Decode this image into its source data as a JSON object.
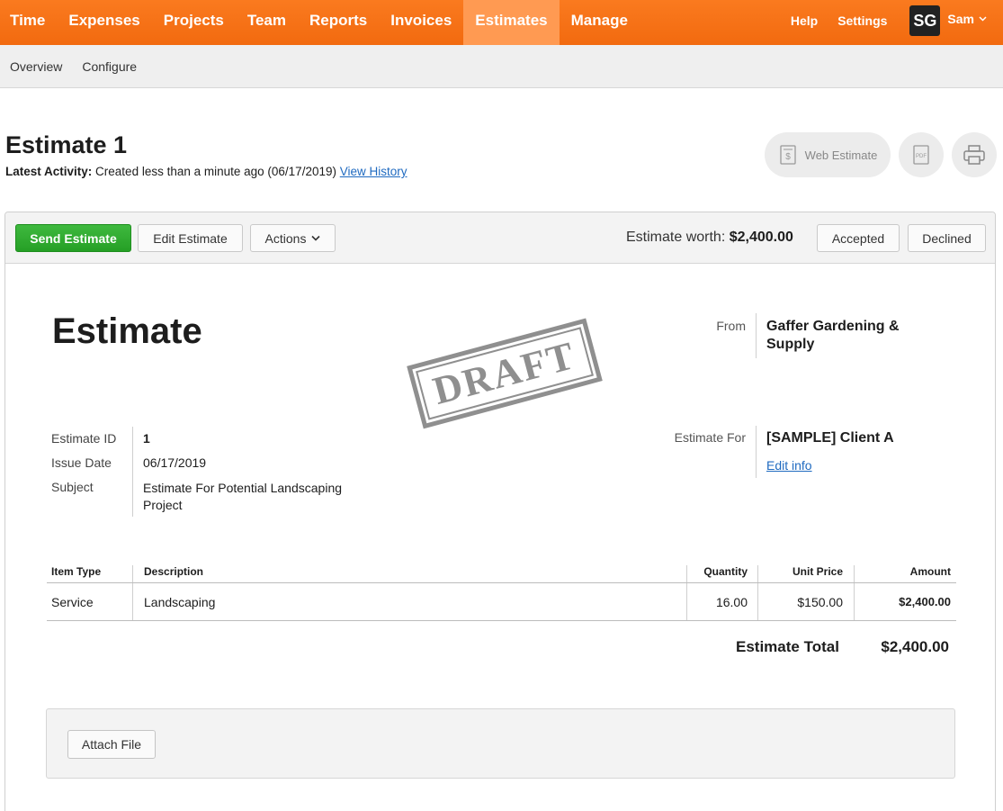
{
  "nav": {
    "items": [
      {
        "label": "Time",
        "active": false
      },
      {
        "label": "Expenses",
        "active": false
      },
      {
        "label": "Projects",
        "active": false
      },
      {
        "label": "Team",
        "active": false
      },
      {
        "label": "Reports",
        "active": false
      },
      {
        "label": "Invoices",
        "active": false
      },
      {
        "label": "Estimates",
        "active": true
      },
      {
        "label": "Manage",
        "active": false
      }
    ],
    "help": "Help",
    "settings": "Settings",
    "avatar_initials": "SG",
    "user_name": "Sam",
    "accent_color": "#f26a0f"
  },
  "subnav": {
    "items": [
      "Overview",
      "Configure"
    ]
  },
  "header": {
    "title": "Estimate 1",
    "activity_label": "Latest Activity:",
    "activity_text": "Created less than a minute ago (06/17/2019)",
    "history_link": "View History",
    "web_estimate": "Web Estimate",
    "pdf_label": "PDF"
  },
  "toolbar": {
    "send": "Send Estimate",
    "edit": "Edit Estimate",
    "actions": "Actions",
    "worth_label": "Estimate worth:",
    "worth_value": "$2,400.00",
    "accepted": "Accepted",
    "declined": "Declined",
    "send_color": "#2ba82b"
  },
  "document": {
    "title": "Estimate",
    "stamp": "DRAFT",
    "from_label": "From",
    "from_value": "Gaffer Gardening & Supply",
    "meta": {
      "id_label": "Estimate ID",
      "id_value": "1",
      "date_label": "Issue Date",
      "date_value": "06/17/2019",
      "subject_label": "Subject",
      "subject_value": "Estimate For Potential Landscaping Project"
    },
    "for_label": "Estimate For",
    "for_value": "[SAMPLE] Client A",
    "edit_info": "Edit info",
    "table": {
      "headers": [
        "Item Type",
        "Description",
        "Quantity",
        "Unit Price",
        "Amount"
      ],
      "rows": [
        [
          "Service",
          "Landscaping",
          "16.00",
          "$150.00",
          "$2,400.00"
        ]
      ]
    },
    "total_label": "Estimate Total",
    "total_value": "$2,400.00",
    "attach": "Attach File"
  }
}
